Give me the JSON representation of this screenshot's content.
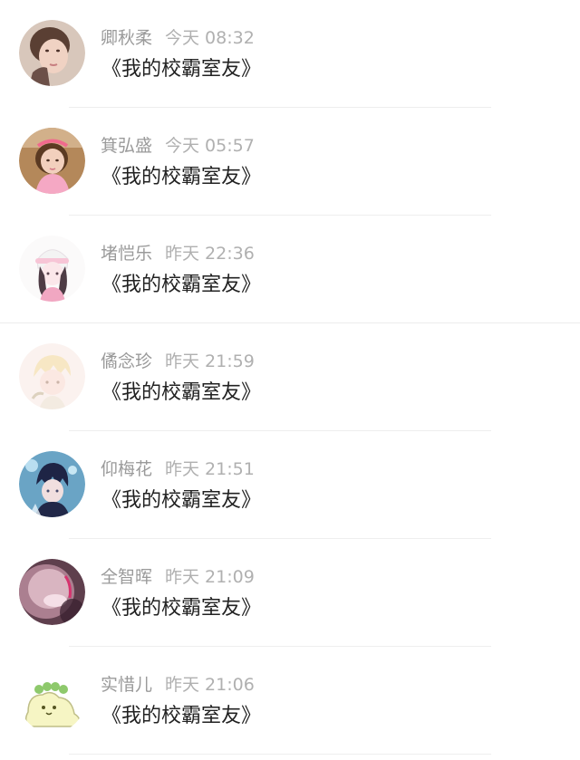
{
  "messages": [
    {
      "name": "卿秋柔",
      "time": "今天 08:32",
      "text": "《我的校霸室友》",
      "avatar_icon": "woman-portrait-avatar"
    },
    {
      "name": "箕弘盛",
      "time": "今天 05:57",
      "text": "《我的校霸室友》",
      "avatar_icon": "child-portrait-avatar"
    },
    {
      "name": "堵恺乐",
      "time": "昨天 22:36",
      "text": "《我的校霸室友》",
      "avatar_icon": "anime-girl-avatar"
    },
    {
      "name": "僪念珍",
      "time": "昨天 21:59",
      "text": "《我的校霸室友》",
      "avatar_icon": "faded-anime-avatar"
    },
    {
      "name": "仰梅花",
      "time": "昨天 21:51",
      "text": "《我的校霸室友》",
      "avatar_icon": "anime-boy-avatar"
    },
    {
      "name": "全智晖",
      "time": "昨天 21:09",
      "text": "《我的校霸室友》",
      "avatar_icon": "blurred-face-avatar"
    },
    {
      "name": "实惜儿",
      "time": "昨天 21:06",
      "text": "《我的校霸室友》",
      "avatar_icon": "cartoon-blob-avatar"
    }
  ],
  "colors": {
    "background": "#ffffff",
    "name_text": "#9a9a9a",
    "time_text": "#b0b0b0",
    "message_text": "#222222",
    "divider": "#eeeeee"
  }
}
